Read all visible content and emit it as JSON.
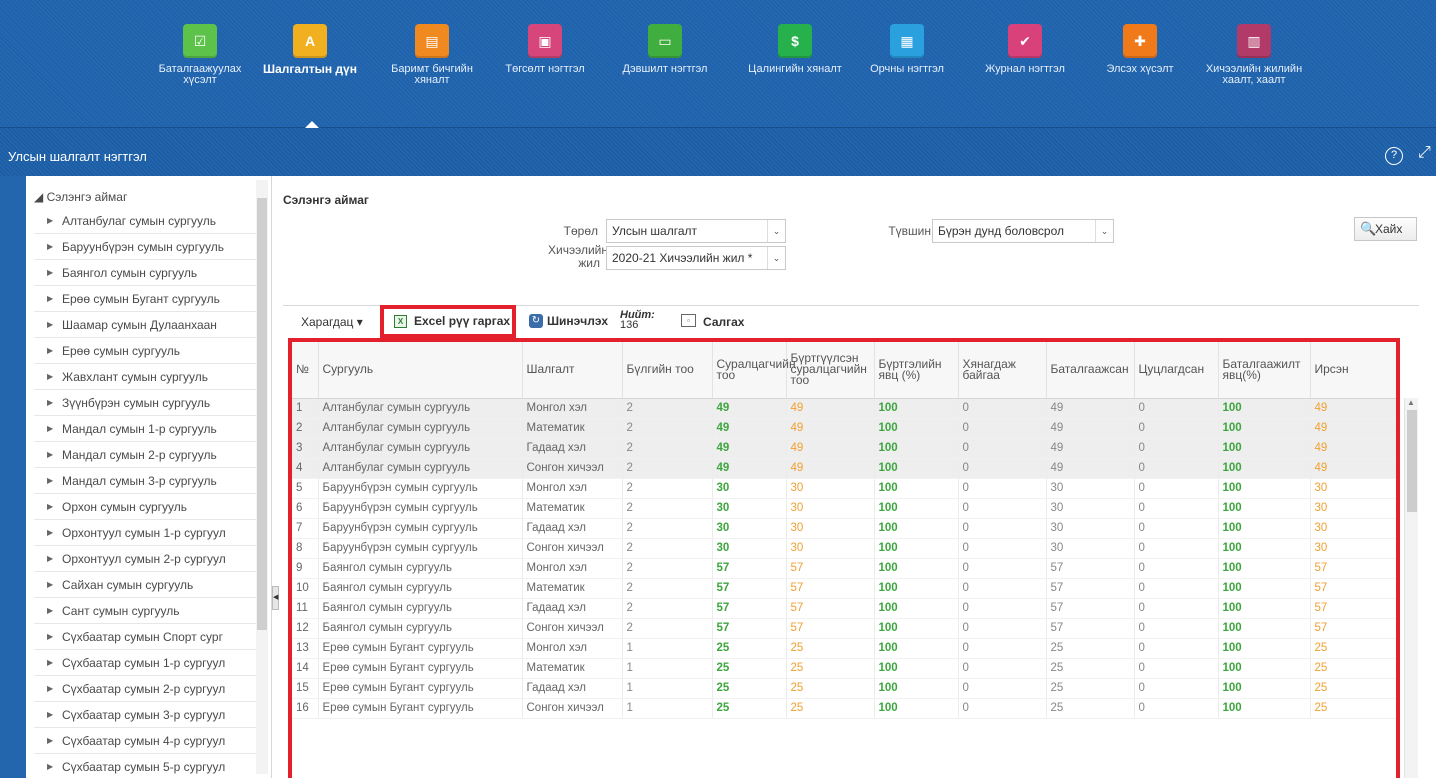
{
  "nav": {
    "items": [
      {
        "label": "Баталгаажуулах хүсэлт",
        "color": "#5cc24a"
      },
      {
        "label": "Шалгалтын дүн",
        "color": "#f0b020"
      },
      {
        "label": "Баримт бичгийн хяналт",
        "color": "#f08a20"
      },
      {
        "label": "Төгсөлт нэгтгэл",
        "color": "#d6467a"
      },
      {
        "label": "Дэвшилт нэгтгэл",
        "color": "#3fae3f"
      },
      {
        "label": "Цалингийн хяналт",
        "color": "#27b14d"
      },
      {
        "label": "Орчны нэгтгэл",
        "color": "#2aa0df"
      },
      {
        "label": "Журнал нэгтгэл",
        "color": "#d8417a"
      },
      {
        "label": "Элсэх хүсэлт",
        "color": "#f07a1a"
      },
      {
        "label": "Хичээлийн жилийн хаалт, хаалт",
        "color": "#b23a68"
      }
    ]
  },
  "region": {
    "title": "Улсын шалгалт нэгтгэл",
    "help": "?",
    "expand": "⤢"
  },
  "tree": {
    "root": "◢ Сэлэнгэ аймаг",
    "items": [
      "Алтанбулаг сумын сургууль",
      "Баруунбүрэн сумын сургууль",
      "Баянгол сумын сургууль",
      "Ерөө сумын Бугант сургууль",
      "Шаамар сумын Дулаанхаан",
      "Ерөө сумын сургууль",
      "Жавхлант сумын сургууль",
      "Зүүнбүрэн сумын сургууль",
      "Мандал сумын 1-р сургууль",
      "Мандал сумын 2-р сургууль",
      "Мандал сумын 3-р сургууль",
      "Орхон сумын сургууль",
      "Орхонтуул сумын 1-р сургуул",
      "Орхонтуул сумын 2-р сургуул",
      "Сайхан сумын сургууль",
      "Сант сумын сургууль",
      "Сүхбаатар сумын Спорт сург",
      "Сүхбаатар сумын 1-р сургуул",
      "Сүхбаатар сумын 2-р сургуул",
      "Сүхбаатар сумын 3-р сургуул",
      "Сүхбаатар сумын 4-р сургуул",
      "Сүхбаатар сумын 5-р сургуул"
    ]
  },
  "filters": {
    "crumb": "Сэлэнгэ аймаг",
    "type_label": "Төрөл",
    "type_value": "Улсын шалгалт",
    "level_label": "Түвшин",
    "level_value": "Бүрэн дунд боловсрол",
    "year_label_1": "Хичээлийн",
    "year_label_2": "жил",
    "year_value": "2020-21 Хичээлийн жил *",
    "search": "Хайх"
  },
  "toolbar": {
    "view": "Харагдац ▾",
    "excel": "Excel рүү гаргах",
    "refresh": "Шинэчлэх",
    "total_label": "Нийт:",
    "total_value": "136",
    "detach": "Салгах"
  },
  "table": {
    "headers": [
      "№",
      "Сургууль",
      "Шалгалт",
      "Бүлгийн тоо",
      "Суралцагчийн тоо",
      "Бүртгүүлсэн суралцагчийн тоо",
      "Бүртгэлийн явц (%)",
      "Хянагдаж байгаа",
      "Баталгаажсан",
      "Цуцлагдсан",
      "Баталгаажилт явц(%)",
      "Ирсэн"
    ],
    "rows": [
      [
        "1",
        "Алтанбулаг сумын сургууль",
        "Монгол хэл",
        "2",
        "49",
        "49",
        "100",
        "0",
        "49",
        "0",
        "100",
        "49"
      ],
      [
        "2",
        "Алтанбулаг сумын сургууль",
        "Математик",
        "2",
        "49",
        "49",
        "100",
        "0",
        "49",
        "0",
        "100",
        "49"
      ],
      [
        "3",
        "Алтанбулаг сумын сургууль",
        "Гадаад хэл",
        "2",
        "49",
        "49",
        "100",
        "0",
        "49",
        "0",
        "100",
        "49"
      ],
      [
        "4",
        "Алтанбулаг сумын сургууль",
        "Сонгон хичээл",
        "2",
        "49",
        "49",
        "100",
        "0",
        "49",
        "0",
        "100",
        "49"
      ],
      [
        "5",
        "Баруунбүрэн сумын сургууль",
        "Монгол хэл",
        "2",
        "30",
        "30",
        "100",
        "0",
        "30",
        "0",
        "100",
        "30"
      ],
      [
        "6",
        "Баруунбүрэн сумын сургууль",
        "Математик",
        "2",
        "30",
        "30",
        "100",
        "0",
        "30",
        "0",
        "100",
        "30"
      ],
      [
        "7",
        "Баруунбүрэн сумын сургууль",
        "Гадаад хэл",
        "2",
        "30",
        "30",
        "100",
        "0",
        "30",
        "0",
        "100",
        "30"
      ],
      [
        "8",
        "Баруунбүрэн сумын сургууль",
        "Сонгон хичээл",
        "2",
        "30",
        "30",
        "100",
        "0",
        "30",
        "0",
        "100",
        "30"
      ],
      [
        "9",
        "Баянгол сумын сургууль",
        "Монгол хэл",
        "2",
        "57",
        "57",
        "100",
        "0",
        "57",
        "0",
        "100",
        "57"
      ],
      [
        "10",
        "Баянгол сумын сургууль",
        "Математик",
        "2",
        "57",
        "57",
        "100",
        "0",
        "57",
        "0",
        "100",
        "57"
      ],
      [
        "11",
        "Баянгол сумын сургууль",
        "Гадаад хэл",
        "2",
        "57",
        "57",
        "100",
        "0",
        "57",
        "0",
        "100",
        "57"
      ],
      [
        "12",
        "Баянгол сумын сургууль",
        "Сонгон хичээл",
        "2",
        "57",
        "57",
        "100",
        "0",
        "57",
        "0",
        "100",
        "57"
      ],
      [
        "13",
        "Ерөө сумын Бугант сургууль",
        "Монгол хэл",
        "1",
        "25",
        "25",
        "100",
        "0",
        "25",
        "0",
        "100",
        "25"
      ],
      [
        "14",
        "Ерөө сумын Бугант сургууль",
        "Математик",
        "1",
        "25",
        "25",
        "100",
        "0",
        "25",
        "0",
        "100",
        "25"
      ],
      [
        "15",
        "Ерөө сумын Бугант сургууль",
        "Гадаад хэл",
        "1",
        "25",
        "25",
        "100",
        "0",
        "25",
        "0",
        "100",
        "25"
      ],
      [
        "16",
        "Ерөө сумын Бугант сургууль",
        "Сонгон хичээл",
        "1",
        "25",
        "25",
        "100",
        "0",
        "25",
        "0",
        "100",
        "25"
      ]
    ]
  },
  "colors": {
    "accent": "#2466ae",
    "highlight": "#e3212c",
    "green_value": "#3da63d",
    "orange_value": "#f0a030"
  }
}
